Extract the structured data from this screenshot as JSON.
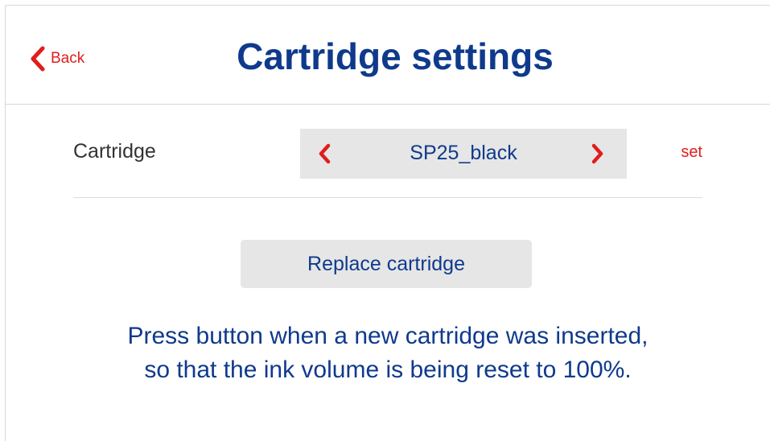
{
  "header": {
    "back_label": "Back",
    "title": "Cartridge settings"
  },
  "cartridge_row": {
    "label": "Cartridge",
    "selected_value": "SP25_black",
    "set_label": "set"
  },
  "replace_button_label": "Replace cartridge",
  "hint": {
    "line1": "Press button when a new cartridge was inserted,",
    "line2": "so that the ink volume is being reset to 100%."
  },
  "colors": {
    "title_blue": "#0f3a8c",
    "accent_red": "#e01d1d",
    "button_gray": "#e6e6e6"
  },
  "icons": {
    "back": "chevron-left-icon",
    "prev": "chevron-left-icon",
    "next": "chevron-right-icon"
  }
}
